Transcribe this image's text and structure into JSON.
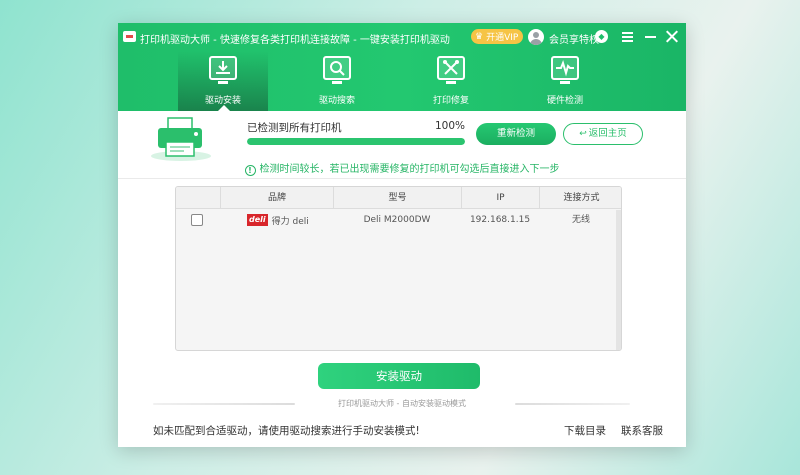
{
  "window": {
    "title": "打印机驱动大师 - 快速修复各类打印机连接故障 - 一键安装打印机驱动",
    "vip_label": "开通VIP",
    "member_label": "会员享特权",
    "accent_color": "#1fbe6a"
  },
  "nav": {
    "tabs": [
      {
        "label": "驱动安装",
        "icon": "driver-install-icon",
        "active": true
      },
      {
        "label": "驱动搜索",
        "icon": "driver-search-icon",
        "active": false
      },
      {
        "label": "打印修复",
        "icon": "print-repair-icon",
        "active": false
      },
      {
        "label": "硬件检测",
        "icon": "hardware-check-icon",
        "active": false
      }
    ]
  },
  "status": {
    "detected_text": "已检测到所有打印机",
    "percent": "100%",
    "progress": 1.0,
    "redetect_label": "重新检测",
    "home_label": "返回主页",
    "notice": "检测时间较长，若已出现需要修复的打印机可勾选后直接进入下一步"
  },
  "table": {
    "headers": [
      "品牌",
      "型号",
      "IP",
      "连接方式"
    ],
    "rows": [
      {
        "checked": false,
        "brand_logo": "deli",
        "brand": "得力 deli",
        "model": "Deli M2000DW",
        "ip": "192.168.1.15",
        "connection": "无线"
      }
    ]
  },
  "footer": {
    "install_label": "安装驱动",
    "caption": "打印机驱动大师 - 自动安装驱动模式",
    "hint": "如未匹配到合适驱动，请使用驱动搜索进行手动安装模式!",
    "download_link": "下载目录",
    "support_link": "联系客服"
  }
}
